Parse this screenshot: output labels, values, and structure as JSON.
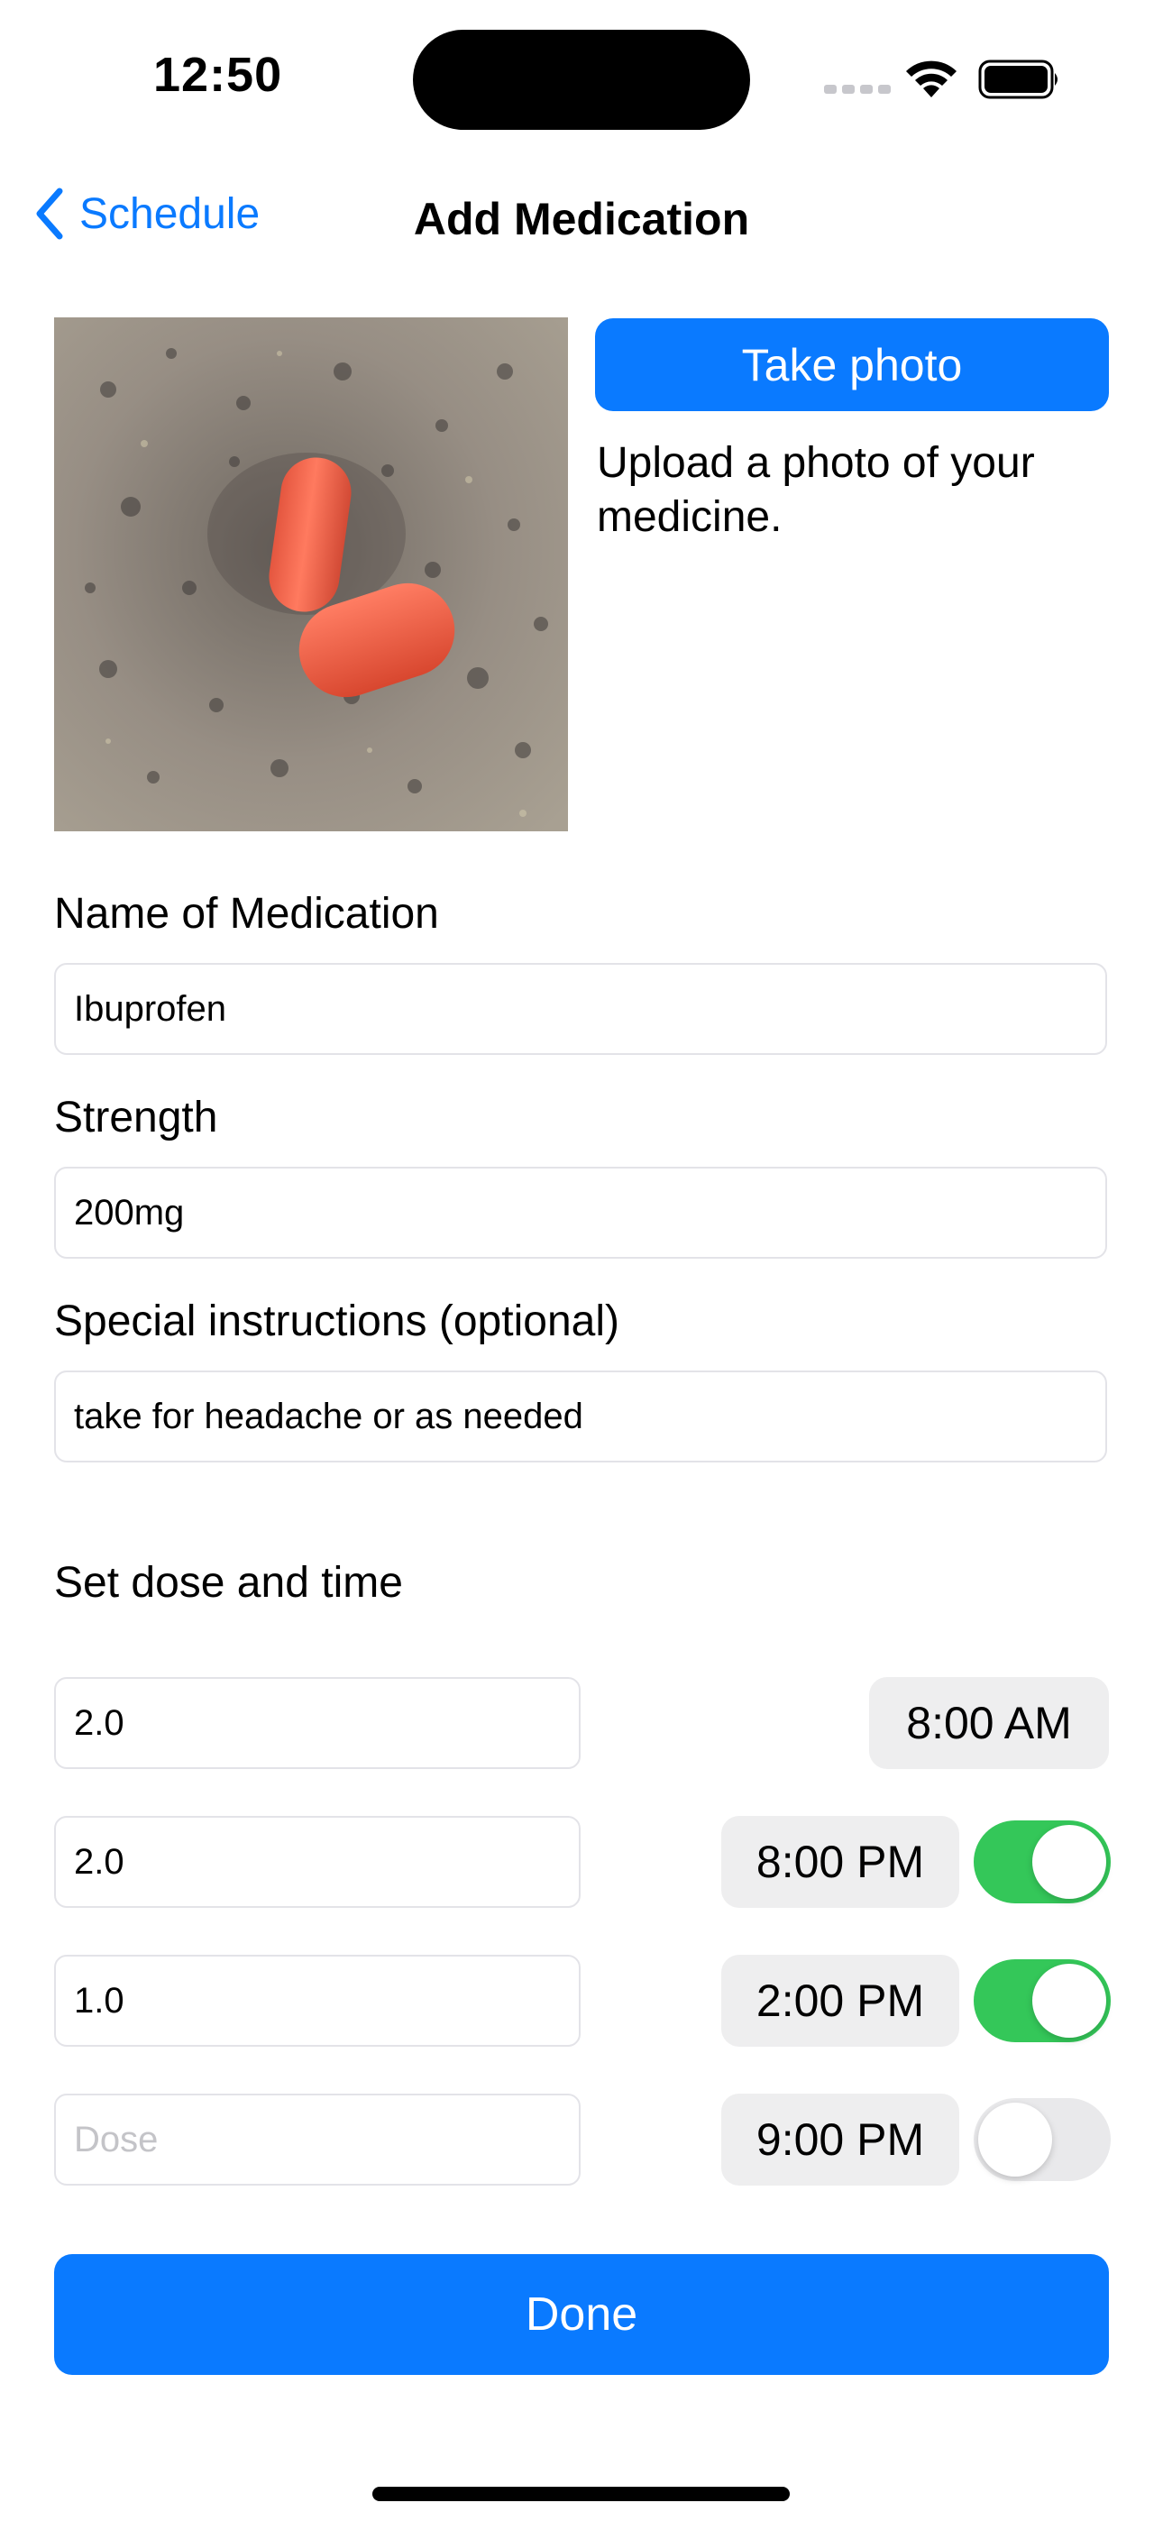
{
  "status_bar": {
    "time": "12:50",
    "icons": [
      "cellular-signal-icon",
      "wifi-icon",
      "battery-icon"
    ]
  },
  "nav": {
    "back_label": "Schedule",
    "title": "Add Medication"
  },
  "photo": {
    "take_photo_label": "Take photo",
    "upload_hint": "Upload a photo of your medicine."
  },
  "form": {
    "name_label": "Name of Medication",
    "name_value": "Ibuprofen",
    "strength_label": "Strength",
    "strength_value": "200mg",
    "instructions_label": "Special instructions (optional)",
    "instructions_value": "take for headache or as needed"
  },
  "schedule": {
    "section_label": "Set dose and time",
    "doses": [
      {
        "dose": "2.0",
        "time": "8:00 AM",
        "toggle": null
      },
      {
        "dose": "2.0",
        "time": "8:00 PM",
        "toggle": true
      },
      {
        "dose": "1.0",
        "time": "2:00 PM",
        "toggle": true
      },
      {
        "dose": "",
        "placeholder": "Dose",
        "time": "9:00 PM",
        "toggle": false
      }
    ]
  },
  "done_label": "Done",
  "colors": {
    "accent": "#0a7aff",
    "toggle_on": "#34c759",
    "toggle_off": "#e9e9eb",
    "time_pill_bg": "#eeeeef",
    "field_border": "#e3e3e8"
  }
}
